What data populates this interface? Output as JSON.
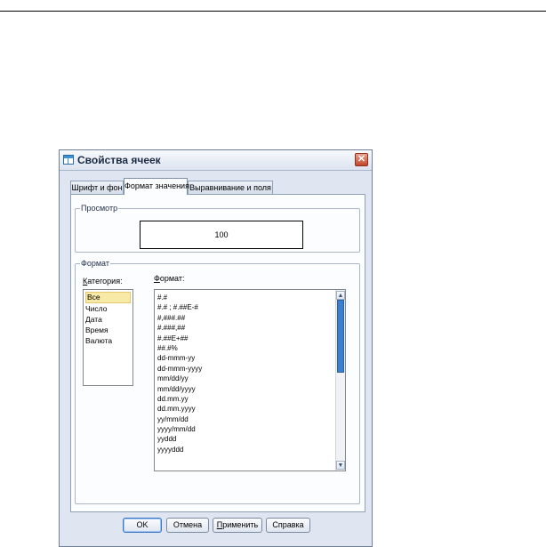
{
  "dialog": {
    "title": "Свойства ячеек",
    "close_symbol": "✕",
    "icon": "table-icon"
  },
  "tabs": [
    {
      "label": "Шрифт и фон",
      "active": false
    },
    {
      "label": "Формат значения",
      "active": true
    },
    {
      "label": "Выравнивание и поля",
      "active": false
    }
  ],
  "preview": {
    "legend": "Просмотр",
    "value": "100"
  },
  "format": {
    "legend": "Формат",
    "category_label_prefix": "К",
    "category_label_rest": "атегория:",
    "format_label_prefix": "Ф",
    "format_label_rest": "ормат:",
    "categories": [
      "Все",
      "Число",
      "Дата",
      "Время",
      "Валюта"
    ],
    "selected_category": "Все",
    "formats": [
      "#.#",
      "#.# ; #.##E-#",
      "#,###.##",
      "#.###,##",
      "#.##E+##",
      "##.#%",
      "dd-mmm-yy",
      "dd-mmm-yyyy",
      "mm/dd/yy",
      "mm/dd/yyyy",
      "dd.mm.yy",
      "dd.mm.yyyy",
      "yy/mm/dd",
      "yyyy/mm/dd",
      "yyddd",
      "yyyyddd"
    ]
  },
  "buttons": {
    "ok": "OK",
    "cancel": "Отмена",
    "apply_prefix": "П",
    "apply_rest": "рименить",
    "help": "Справка"
  },
  "colors": {
    "selection": "#f7e9a6",
    "scroll_thumb": "#3a7fd0",
    "close_button": "#c2462a"
  }
}
